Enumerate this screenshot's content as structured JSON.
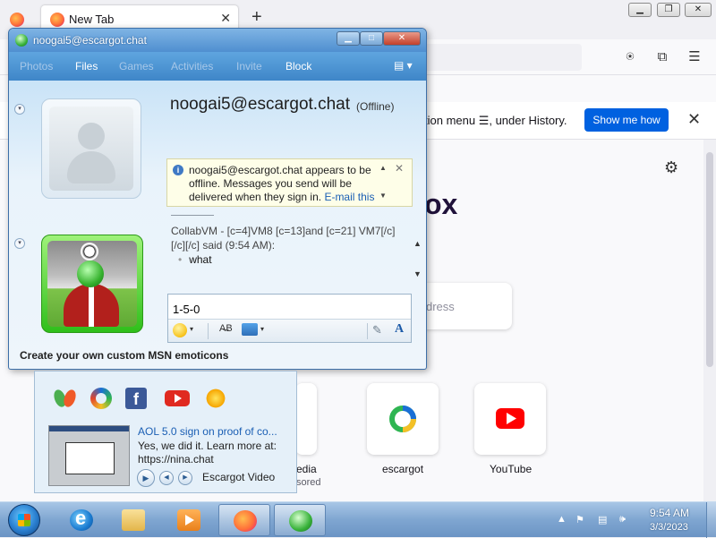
{
  "firefox": {
    "tab_title": "New Tab",
    "tab_close": "✕",
    "new_tab": "+",
    "caption": {
      "minimize": "▁",
      "maximize": "❐",
      "close": "✕"
    },
    "notification_text": "tion menu ☰, under History.",
    "notification_button": "Show me how",
    "notification_close": "✕",
    "brand_text": "ox",
    "search_placeholder_fragment": "dress",
    "shortcuts": [
      {
        "label": "edia",
        "sublabel": "sored"
      },
      {
        "label": "escargot"
      },
      {
        "label": "YouTube"
      }
    ],
    "icons": {
      "pocket": "⍟",
      "extensions": "⧉",
      "menu": "☰",
      "settings": "⚙"
    }
  },
  "msn": {
    "window_title": "noogai5@escargot.chat",
    "caption": {
      "minimize": "▁",
      "maximize": "□",
      "close": "✕"
    },
    "toolbar": {
      "photos": "Photos",
      "files": "Files",
      "games": "Games",
      "activities": "Activities",
      "invite": "Invite",
      "block": "Block",
      "menu": "▤ ▾"
    },
    "contact_name": "noogai5@escargot.chat",
    "contact_status": "(Offline)",
    "offline_notice": "noogai5@escargot.chat appears to be offline. Messages you send will be delivered when they sign in.",
    "offline_link": "E-mail this",
    "offline_info_icon": "i",
    "offline_close": "✕",
    "scroll_up": "▲",
    "scroll_down": "▼",
    "chat_sender_line": "CollabVM - [c=4]VM8 [c=13]and [c=21] VM7[/c][/c][/c] said (9:54 AM):",
    "chat_message": "what",
    "input_value": "1-5-0",
    "input_toolbar": {
      "spell": "A̶B",
      "dropdown": "▾",
      "handwrite": "✎",
      "font": "A"
    },
    "collapse_glyph": "▾",
    "footer_link": "Create your own custom MSN emoticons",
    "accent": "#3f86c8"
  },
  "ad": {
    "icons": [
      "msn-butterfly-icon",
      "edge-icon",
      "facebook-icon",
      "youtube-icon",
      "weather-icon"
    ],
    "facebook_glyph": "f",
    "title": "AOL 5.0 sign on proof of co...",
    "description": "Yes, we did it. Learn more at: https://nina.chat",
    "controls": {
      "play": "▶",
      "prev": "◀",
      "next": "▶"
    },
    "label": "Escargot Video"
  },
  "taskbar": {
    "tray": {
      "arrow": "▲",
      "flag": "⚑",
      "network": "▤",
      "volume": "🕪"
    },
    "time": "9:54 AM",
    "date": "3/3/2023"
  }
}
